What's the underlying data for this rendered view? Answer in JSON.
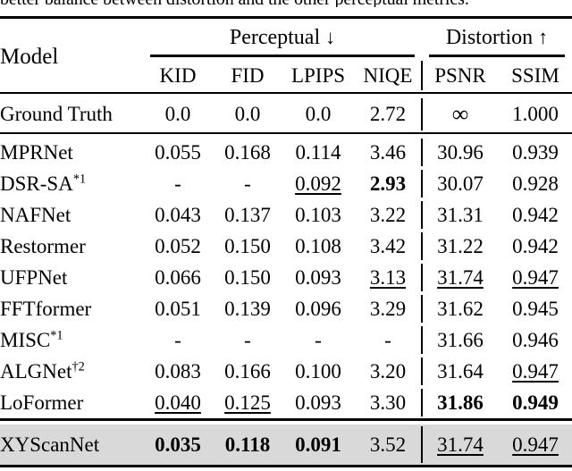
{
  "caption_fragment": "better balance between distortion and the other perceptual metrics.",
  "table": {
    "model_header": "Model",
    "groups": [
      {
        "label": "Perceptual",
        "arrow": "↓",
        "span": 4
      },
      {
        "label": "Distortion",
        "arrow": "↑",
        "span": 2
      }
    ],
    "columns": [
      "Model",
      "KID",
      "FID",
      "LPIPS",
      "NIQE",
      "PSNR",
      "SSIM"
    ],
    "reference_row": {
      "model": "Ground Truth",
      "model_sup": "",
      "values": [
        "0.0",
        "0.0",
        "0.0",
        "2.72",
        "∞",
        "1.000"
      ],
      "styles": [
        "",
        "",
        "",
        "",
        "inf",
        ""
      ]
    },
    "rows": [
      {
        "model": "MPRNet",
        "model_sup": "",
        "values": [
          "0.055",
          "0.168",
          "0.114",
          "3.46",
          "30.96",
          "0.939"
        ],
        "styles": [
          "",
          "",
          "",
          "",
          "",
          ""
        ],
        "highlight": false
      },
      {
        "model": "DSR-SA",
        "model_sup": "*1",
        "values": [
          "-",
          "-",
          "0.092",
          "2.93",
          "30.07",
          "0.928"
        ],
        "styles": [
          "",
          "",
          "u",
          "b",
          "",
          ""
        ],
        "highlight": false
      },
      {
        "model": "NAFNet",
        "model_sup": "",
        "values": [
          "0.043",
          "0.137",
          "0.103",
          "3.22",
          "31.31",
          "0.942"
        ],
        "styles": [
          "",
          "",
          "",
          "",
          "",
          ""
        ],
        "highlight": false
      },
      {
        "model": "Restormer",
        "model_sup": "",
        "values": [
          "0.052",
          "0.150",
          "0.108",
          "3.42",
          "31.22",
          "0.942"
        ],
        "styles": [
          "",
          "",
          "",
          "",
          "",
          ""
        ],
        "highlight": false
      },
      {
        "model": "UFPNet",
        "model_sup": "",
        "values": [
          "0.066",
          "0.150",
          "0.093",
          "3.13",
          "31.74",
          "0.947"
        ],
        "styles": [
          "",
          "",
          "",
          "u",
          "u",
          "u"
        ],
        "highlight": false
      },
      {
        "model": "FFTformer",
        "model_sup": "",
        "values": [
          "0.051",
          "0.139",
          "0.096",
          "3.29",
          "31.62",
          "0.945"
        ],
        "styles": [
          "",
          "",
          "",
          "",
          "",
          ""
        ],
        "highlight": false
      },
      {
        "model": "MISC",
        "model_sup": "*1",
        "values": [
          "-",
          "-",
          "-",
          "-",
          "31.66",
          "0.946"
        ],
        "styles": [
          "",
          "",
          "",
          "",
          "",
          ""
        ],
        "highlight": false
      },
      {
        "model": "ALGNet",
        "model_sup": "†2",
        "values": [
          "0.083",
          "0.166",
          "0.100",
          "3.20",
          "31.64",
          "0.947"
        ],
        "styles": [
          "",
          "",
          "",
          "",
          "",
          "u"
        ],
        "highlight": false
      },
      {
        "model": "LoFormer",
        "model_sup": "",
        "values": [
          "0.040",
          "0.125",
          "0.093",
          "3.30",
          "31.86",
          "0.949"
        ],
        "styles": [
          "u",
          "u",
          "",
          "",
          "b",
          "b"
        ],
        "highlight": false
      },
      {
        "model": "XYScanNet",
        "model_sup": "",
        "values": [
          "0.035",
          "0.118",
          "0.091",
          "3.52",
          "31.74",
          "0.947"
        ],
        "styles": [
          "b",
          "b",
          "b",
          "",
          "u",
          "u"
        ],
        "highlight": true
      }
    ],
    "highlight_color": "#d9d9d9"
  }
}
